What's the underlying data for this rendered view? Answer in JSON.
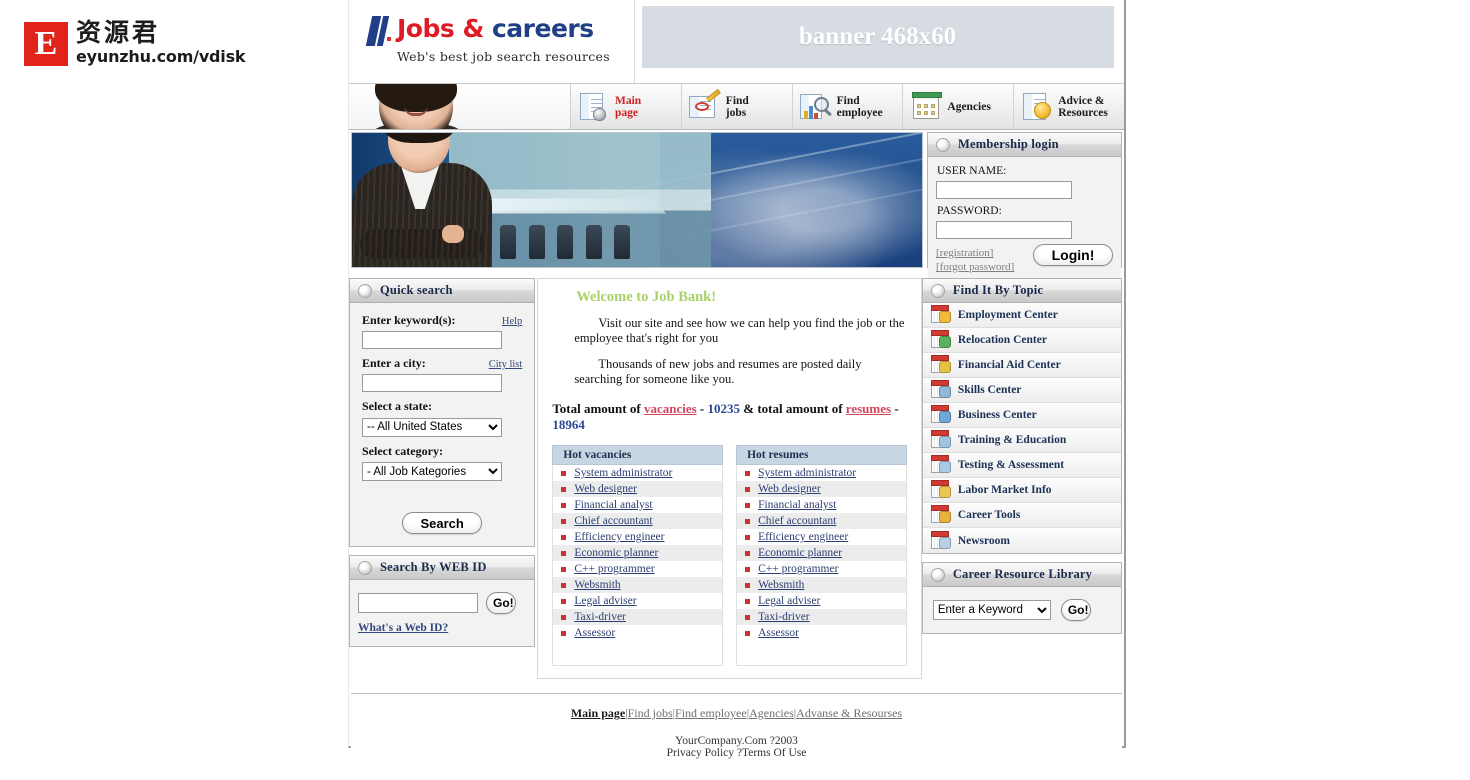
{
  "watermark": {
    "badge_letter": "E",
    "cn_text": "资源君",
    "url": "eyunzhu.com/vdisk"
  },
  "header": {
    "logo_jobs": "Jobs",
    "logo_amp": " & ",
    "logo_careers": "careers",
    "tagline": "Web's best job search resources",
    "banner_text": "banner 468x60"
  },
  "nav": {
    "items": [
      {
        "label": "Main\npage",
        "line1": "Main",
        "line2": "page",
        "icon": "document-mouse-icon",
        "active": true
      },
      {
        "label": "Find jobs",
        "line1": "Find",
        "line2": "jobs",
        "icon": "newspaper-pencil-icon",
        "active": false
      },
      {
        "label": "Find employee",
        "line1": "Find",
        "line2": "employee",
        "icon": "chart-magnifier-icon",
        "active": false
      },
      {
        "label": "Agencies",
        "line1": "Agencies",
        "line2": "",
        "icon": "building-icon",
        "active": false
      },
      {
        "label": "Advice & Resources",
        "line1": "Advice &",
        "line2": "Resources",
        "icon": "document-badge-icon",
        "active": false
      }
    ]
  },
  "login": {
    "title": "Membership login",
    "username_label": "USER NAME:",
    "username_value": "",
    "password_label": "PASSWORD:",
    "password_value": "",
    "registration_link": "[registration]",
    "forgot_link": "[forgot password]",
    "button": "Login!"
  },
  "quick_search": {
    "title": "Quick search",
    "keyword_label": "Enter keyword(s):",
    "help_link": "Help",
    "keyword_value": "",
    "city_label": "Enter a city:",
    "city_list_link": "City list",
    "city_value": "",
    "state_label": "Select a state:",
    "state_value": "-- All United States",
    "category_label": "Select category:",
    "category_value": "- All Job Kategories",
    "search_button": "Search"
  },
  "web_id": {
    "title": "Search By WEB ID",
    "input_value": "",
    "go_button": "Go!",
    "help_link": "What's a Web ID?"
  },
  "main": {
    "welcome_title": "Welcome to Job Bank!",
    "paragraph1": "Visit our site and see how we can help you find the job or the employee that's right for you",
    "paragraph2": "Thousands of new jobs and resumes are posted daily searching for someone like you.",
    "totals_prefix": "Total amount of ",
    "totals_vacancies_link": "vacancies",
    "totals_dash1": " - ",
    "totals_vacancies_count": "10235",
    "totals_middle": " & total amount of ",
    "totals_resumes_link": "resumes",
    "totals_dash2": " - ",
    "totals_resumes_count": "18964",
    "hot_vacancies_title": "Hot vacancies",
    "hot_resumes_title": "Hot resumes",
    "hot_vacancies": [
      "System administrator",
      "Web designer",
      "Financial analyst",
      "Chief accountant",
      "Efficiency engineer",
      "Economic planner",
      "C++ programmer",
      "Websmith",
      "Legal adviser",
      "Taxi-driver",
      "Assessor"
    ],
    "hot_resumes": [
      "System administrator",
      "Web designer",
      "Financial analyst",
      "Chief accountant",
      "Efficiency engineer",
      "Economic planner",
      "C++ programmer",
      "Websmith",
      "Legal adviser",
      "Taxi-driver",
      "Assessor"
    ]
  },
  "topics": {
    "title": "Find It By Topic",
    "items": [
      {
        "label": "Employment Center",
        "accent": "#f0b93a"
      },
      {
        "label": "Relocation Center",
        "accent": "#5ab45e"
      },
      {
        "label": "Financial Aid Center",
        "accent": "#e8c341"
      },
      {
        "label": "Skills Center",
        "accent": "#8fb8d8"
      },
      {
        "label": "Business Center",
        "accent": "#6fa8d6"
      },
      {
        "label": "Training & Education",
        "accent": "#9fc4e0"
      },
      {
        "label": "Testing & Assessment",
        "accent": "#a8cae4"
      },
      {
        "label": "Labor Market Info",
        "accent": "#e9c552"
      },
      {
        "label": "Career Tools",
        "accent": "#e8b23c"
      },
      {
        "label": "Newsroom",
        "accent": "#b9cfe4"
      }
    ]
  },
  "career_library": {
    "title": "Career Resource Library",
    "select_value": "Enter a Keyword",
    "go_button": "Go!"
  },
  "footer": {
    "links": [
      "Main page",
      "Find jobs",
      "Find employee",
      "Agencies",
      "Advanse & Resourses"
    ],
    "separator": "|",
    "copyright": "YourCompany.Com ?2003",
    "legal": "Privacy Policy ?Terms Of Use"
  },
  "colors": {
    "brand_red": "#e01b24",
    "brand_blue": "#1f3f86",
    "link_blue": "#2c3f73",
    "accent_green": "#a8d168",
    "bullet_red": "#c8342c"
  }
}
